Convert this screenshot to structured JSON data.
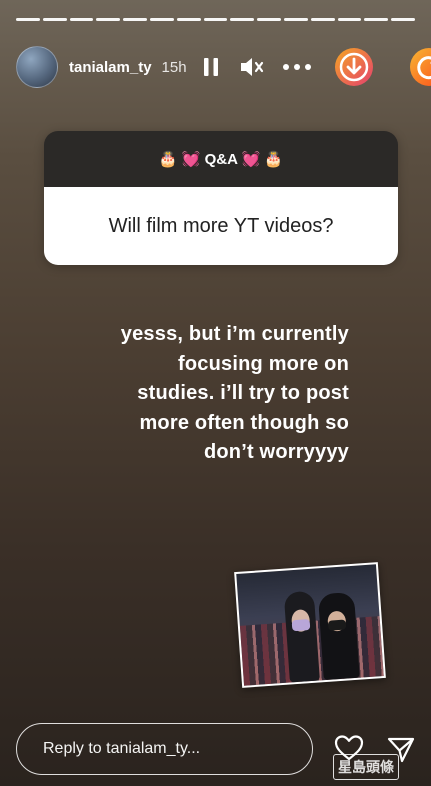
{
  "story": {
    "progress_segments": 15
  },
  "header": {
    "username": "tanialam_ty",
    "time": "15h",
    "icons": [
      "pause-icon",
      "mute-icon",
      "more-icon",
      "save-icon",
      "reload-icon"
    ]
  },
  "qa": {
    "title": "🎂 💓 Q&A 💓 🎂",
    "question": "Will film more YT videos?"
  },
  "answer": {
    "text": "yesss, but i’m currently\nfocusing more on\nstudies. i’ll try to post\nmore often though so\ndon’t worryyyy"
  },
  "reply": {
    "placeholder": "Reply to tanialam_ty..."
  },
  "watermark": {
    "text": "星島頭條"
  },
  "colors": {
    "qa_header": "#2b2927",
    "qa_body": "#ffffff",
    "save_gradient": [
      "#f5a623",
      "#e4406f"
    ],
    "reload_gradient": [
      "#f7b733",
      "#fc4a1a"
    ]
  }
}
